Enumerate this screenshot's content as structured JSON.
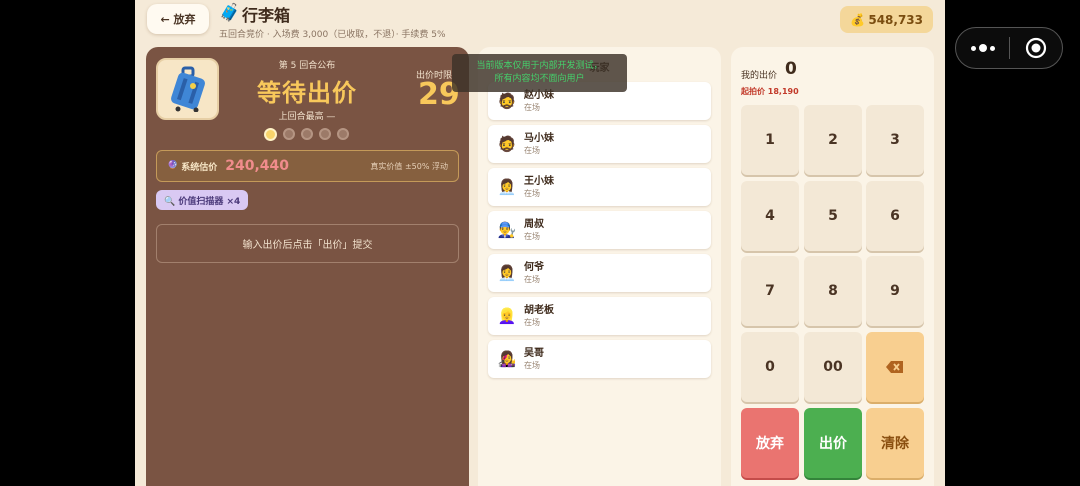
{
  "header": {
    "back_label": "← 放弃",
    "title_icon": "suitcase-icon",
    "title": "行李箱",
    "subtitle": "五回合竞价 · 入场费 3,000（已收取，不退）· 手续费 5%",
    "coins_icon": "money-bag-icon",
    "coins": "548,733"
  },
  "auction": {
    "round_label": "第 5 回合公布",
    "status": "等待出价",
    "prev_high": "上回合最高 —",
    "timer_label": "出价时限",
    "timer": "29",
    "rounds_total": 5,
    "current_round": 1,
    "estimate_icon": "crystal-ball-icon",
    "estimate_label": "系统估价",
    "estimate_value": "240,440",
    "estimate_note": "真实价值 ±50% 浮动",
    "scanner_label": "🔍 价值扫描器 ×4",
    "hint": "输入出价后点击「出价」提交"
  },
  "players": {
    "header": "玩家",
    "list": [
      {
        "avatar": "🧔",
        "name": "赵小妹",
        "state": "在场"
      },
      {
        "avatar": "🧔",
        "name": "马小妹",
        "state": "在场"
      },
      {
        "avatar": "👩‍💼",
        "name": "王小妹",
        "state": "在场"
      },
      {
        "avatar": "👨‍🔧",
        "name": "周叔",
        "state": "在场"
      },
      {
        "avatar": "👩‍💼",
        "name": "何爷",
        "state": "在场"
      },
      {
        "avatar": "👱‍♀️",
        "name": "胡老板",
        "state": "在场"
      },
      {
        "avatar": "👩‍🎤",
        "name": "吴哥",
        "state": "在场"
      }
    ]
  },
  "toast": {
    "line1": "当前版本仅用于内部开发测试，",
    "line2": "所有内容均不面向用户"
  },
  "keypad": {
    "my_bid_label": "我的出价",
    "my_bid": "0",
    "start_price": "起拍价 18,190",
    "keys": [
      "1",
      "2",
      "3",
      "4",
      "5",
      "6",
      "7",
      "8",
      "9",
      "0",
      "00"
    ],
    "backspace_icon": "backspace-icon",
    "give_up": "放弃",
    "bid": "出价",
    "clear": "清除"
  },
  "capsule": {
    "more_icon": "more-dots-icon",
    "close_icon": "target-close-icon"
  },
  "colors": {
    "accent": "#f8c85b",
    "panel": "#7a5443",
    "bid_green": "#4caf50",
    "give_up_red": "#ea7470"
  }
}
